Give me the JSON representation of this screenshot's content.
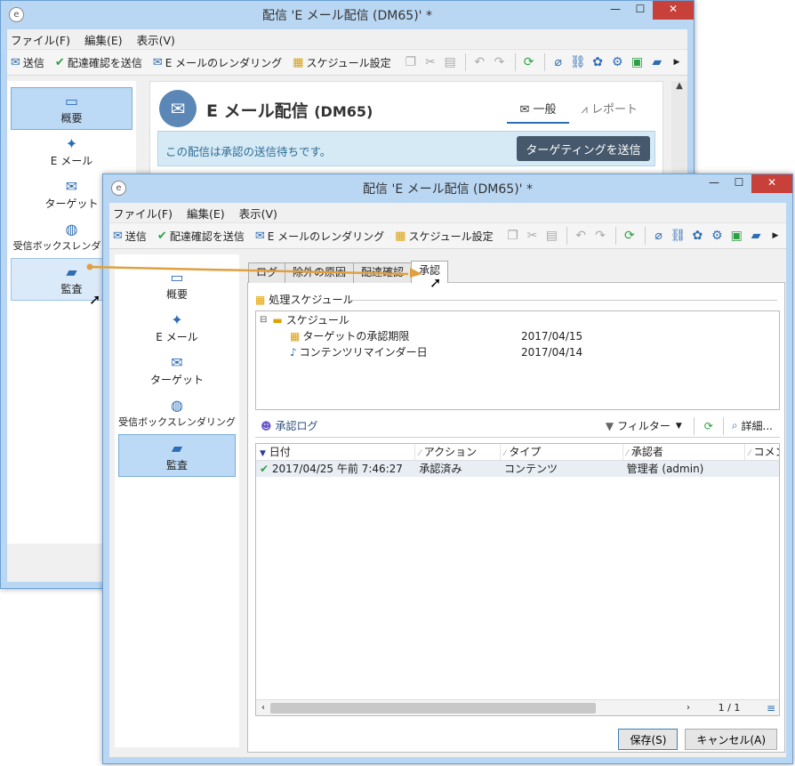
{
  "back_window": {
    "title": "配信 'E メール配信 (DM65)' *",
    "menu": [
      "ファイル(F)",
      "編集(E)",
      "表示(V)"
    ],
    "toolbar": {
      "send": "送信",
      "send_proof": "配達確認を送信",
      "render": "E メールのレンダリング",
      "schedule": "スケジュール設定"
    },
    "sidebar": [
      {
        "label": "概要",
        "icon": "overview-icon"
      },
      {
        "label": "E メール",
        "icon": "email-icon"
      },
      {
        "label": "ターゲット",
        "icon": "target-icon"
      },
      {
        "label": "受信ボックスレンダリング",
        "icon": "globe-icon"
      },
      {
        "label": "監査",
        "icon": "audit-icon"
      }
    ],
    "header": {
      "title": "E メール配信",
      "code": "(DM65)",
      "tab_general": "一般",
      "tab_report": "レポート"
    },
    "notice": {
      "text": "この配信は承認の送信待ちです。",
      "button": "ターゲティングを送信"
    }
  },
  "front_window": {
    "title": "配信 'E メール配信 (DM65)' *",
    "menu": [
      "ファイル(F)",
      "編集(E)",
      "表示(V)"
    ],
    "toolbar": {
      "send": "送信",
      "send_proof": "配達確認を送信",
      "render": "E メールのレンダリング",
      "schedule": "スケジュール設定"
    },
    "sidebar": [
      {
        "label": "概要",
        "icon": "overview-icon"
      },
      {
        "label": "E メール",
        "icon": "email-icon"
      },
      {
        "label": "ターゲット",
        "icon": "target-icon"
      },
      {
        "label": "受信ボックスレンダリング",
        "icon": "globe-icon"
      },
      {
        "label": "監査",
        "icon": "audit-icon"
      }
    ],
    "tabs": [
      "ログ",
      "除外の原因",
      "配達確認",
      "承認"
    ],
    "schedule_group": "処理スケジュール",
    "tree": {
      "root": "スケジュール",
      "items": [
        {
          "label": "ターゲットの承認期限",
          "date": "2017/04/15"
        },
        {
          "label": "コンテンツリマインダー日",
          "date": "2017/04/14"
        }
      ]
    },
    "log_toolbar": {
      "approval_log": "承認ログ",
      "filter": "フィルター",
      "details": "詳細..."
    },
    "grid": {
      "columns": [
        "日付",
        "アクション",
        "タイプ",
        "承認者",
        "コメント"
      ],
      "rows": [
        {
          "date": "2017/04/25 午前 7:46:27",
          "action": "承認済み",
          "type": "コンテンツ",
          "approver": "管理者 (admin)",
          "comment": ""
        }
      ],
      "pagination": "1 / 1"
    },
    "footer": {
      "save": "保存(S)",
      "cancel": "キャンセル(A)"
    }
  },
  "colors": {
    "accent": "#2d6db5",
    "arrow": "#e0a040",
    "title_bg": "#b9d7f3",
    "close": "#c7403a"
  }
}
